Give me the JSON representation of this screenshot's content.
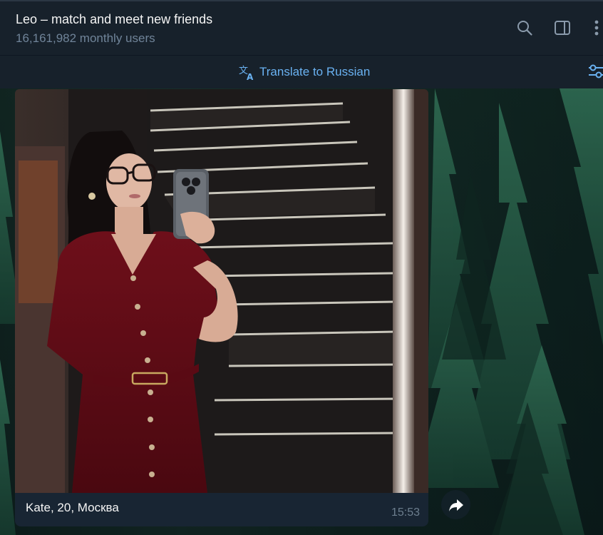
{
  "header": {
    "title": "Leo – match and meet new friends",
    "subtitle": "16,161,982 monthly users",
    "icons": [
      "search-icon",
      "sidebar-panel-icon",
      "more-vertical-icon"
    ]
  },
  "translate_bar": {
    "label": "Translate to Russian",
    "icon": "translate-icon",
    "right_icon": "filters-icon"
  },
  "message": {
    "caption": "Kate, 20, Москва",
    "time": "15:53",
    "photo_alt": "photo"
  },
  "colors": {
    "header_bg": "#17212b",
    "accent": "#6ab2f2",
    "muted": "#708499",
    "bubble": "#182533"
  }
}
